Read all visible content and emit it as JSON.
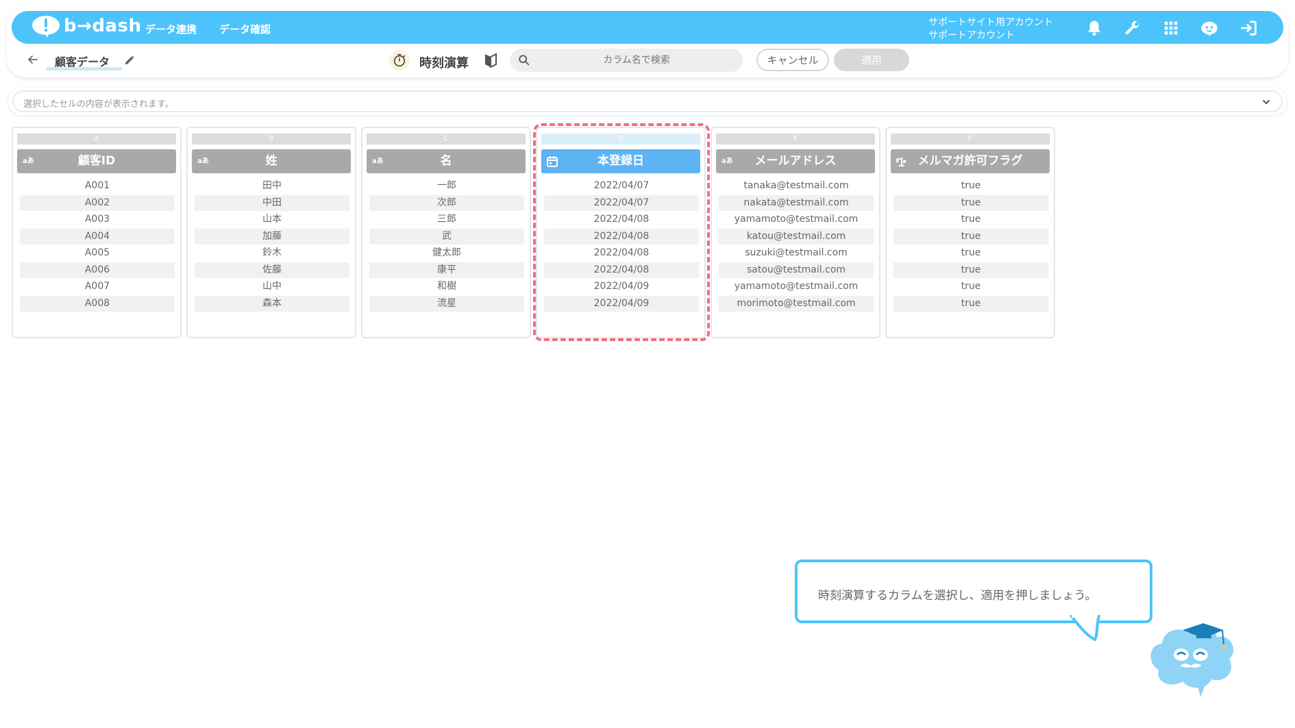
{
  "app": {
    "logo_text": "b→dash",
    "nav": [
      "データ連携",
      "データ確認"
    ],
    "account_line1": "サポートサイト用アカウント",
    "account_line2": "サポートアカウント",
    "brand_color": "#4cc4fb"
  },
  "toolbar": {
    "dataset_name": "顧客データ",
    "panel_title": "時刻演算",
    "search_placeholder": "カラム名で検索",
    "cancel_label": "キャンセル",
    "apply_label": "適用"
  },
  "cellbar": {
    "placeholder": "選択したセルの内容が表示されます。"
  },
  "columns": [
    {
      "letter": "A",
      "name": "顧客ID",
      "type": "text",
      "type_label": "aあ",
      "values": [
        "A001",
        "A002",
        "A003",
        "A004",
        "A005",
        "A006",
        "A007",
        "A008"
      ]
    },
    {
      "letter": "B",
      "name": "姓",
      "type": "text",
      "type_label": "aあ",
      "values": [
        "田中",
        "中田",
        "山本",
        "加藤",
        "鈴木",
        "佐藤",
        "山中",
        "森本"
      ]
    },
    {
      "letter": "C",
      "name": "名",
      "type": "text",
      "type_label": "aあ",
      "values": [
        "一郎",
        "次郎",
        "三郎",
        "武",
        "健太郎",
        "康平",
        "和樹",
        "流星"
      ]
    },
    {
      "letter": "D",
      "name": "本登録日",
      "type": "date",
      "type_label": "",
      "values": [
        "2022/04/07",
        "2022/04/07",
        "2022/04/08",
        "2022/04/08",
        "2022/04/08",
        "2022/04/08",
        "2022/04/09",
        "2022/04/09"
      ]
    },
    {
      "letter": "E",
      "name": "メールアドレス",
      "type": "text",
      "type_label": "aあ",
      "values": [
        "tanaka@testmail.com",
        "nakata@testmail.com",
        "yamamoto@testmail.com",
        "katou@testmail.com",
        "suzuki@testmail.com",
        "satou@testmail.com",
        "yamamoto@testmail.com",
        "morimoto@testmail.com"
      ]
    },
    {
      "letter": "F",
      "name": "メルマガ許可フラグ",
      "type": "boolean",
      "type_label": "",
      "values": [
        "true",
        "true",
        "true",
        "true",
        "true",
        "true",
        "true",
        "true"
      ]
    }
  ],
  "selected_column": "D",
  "tooltip": {
    "text": "時刻演算するカラムを選択し、適用を押しましょう。"
  }
}
